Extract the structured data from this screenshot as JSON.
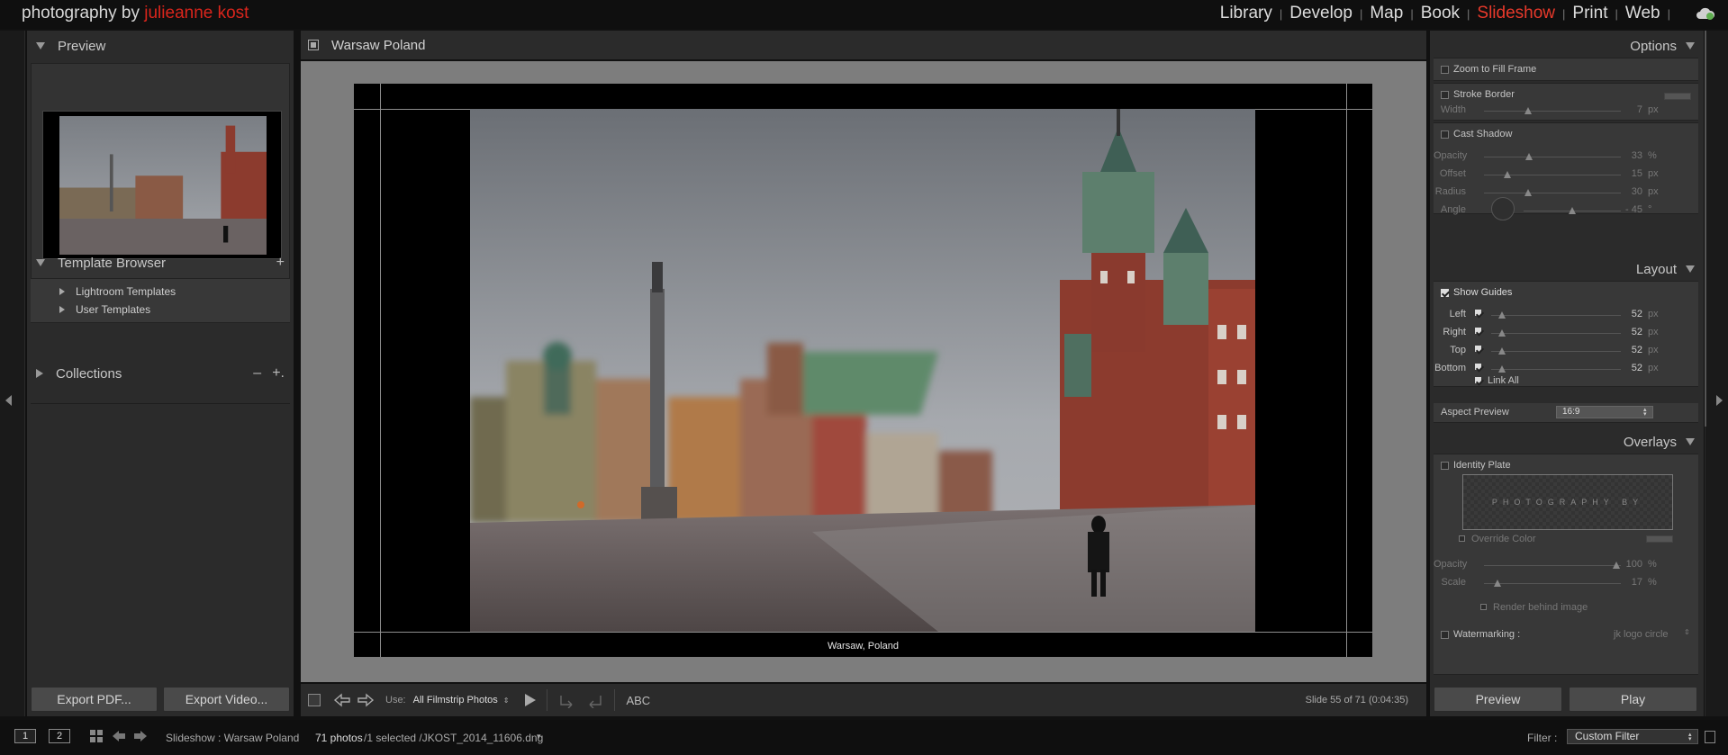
{
  "brand": {
    "prefix": "photography by ",
    "name": "julieanne kost"
  },
  "modules": [
    {
      "label": "Library",
      "active": false
    },
    {
      "label": "Develop",
      "active": false
    },
    {
      "label": "Map",
      "active": false
    },
    {
      "label": "Book",
      "active": false
    },
    {
      "label": "Slideshow",
      "active": true
    },
    {
      "label": "Print",
      "active": false
    },
    {
      "label": "Web",
      "active": false
    }
  ],
  "left_panel": {
    "preview": {
      "title": "Preview"
    },
    "template_browser": {
      "title": "Template Browser",
      "add_symbol": "+",
      "items": [
        "Lightroom Templates",
        "User Templates"
      ]
    },
    "collections": {
      "title": "Collections",
      "minus_symbol": "–",
      "plus_symbol": "+."
    },
    "export_pdf_label": "Export PDF...",
    "export_video_label": "Export Video..."
  },
  "center": {
    "title": "Warsaw Poland",
    "caption": "Warsaw, Poland",
    "toolbar": {
      "use_label": "Use:",
      "use_value": "All Filmstrip Photos",
      "abc_label": "ABC",
      "slide_info": "Slide 55 of 71 (0:04:35)"
    }
  },
  "right_panel": {
    "options": {
      "title": "Options",
      "zoom_to_fill": {
        "label": "Zoom to Fill Frame",
        "checked": false
      },
      "stroke_border": {
        "label": "Stroke Border",
        "checked": false
      },
      "width": {
        "label": "Width",
        "value": "7",
        "unit": "px",
        "level": 0.32
      },
      "cast_shadow": {
        "label": "Cast Shadow",
        "checked": false
      },
      "opacity": {
        "label": "Opacity",
        "value": "33",
        "unit": "%",
        "level": 0.33
      },
      "offset": {
        "label": "Offset",
        "value": "15",
        "unit": "px",
        "level": 0.17
      },
      "radius": {
        "label": "Radius",
        "value": "30",
        "unit": "px",
        "level": 0.32
      },
      "angle": {
        "label": "Angle",
        "value": "- 45",
        "unit": "°",
        "level": 0.5
      }
    },
    "layout": {
      "title": "Layout",
      "show_guides": {
        "label": "Show Guides",
        "checked": true
      },
      "left": {
        "label": "Left",
        "value": "52",
        "unit": "px",
        "level": 0.08
      },
      "right": {
        "label": "Right",
        "value": "52",
        "unit": "px",
        "level": 0.08
      },
      "top": {
        "label": "Top",
        "value": "52",
        "unit": "px",
        "level": 0.08
      },
      "bottom": {
        "label": "Bottom",
        "value": "52",
        "unit": "px",
        "level": 0.08
      },
      "link_all": "Link All",
      "aspect_preview_label": "Aspect Preview",
      "aspect_preview_value": "16:9"
    },
    "overlays": {
      "title": "Overlays",
      "identity_plate": {
        "label": "Identity Plate",
        "checked": false
      },
      "identity_plate_text": "PHOTOGRAPHY BY",
      "override_color": "Override Color",
      "opacity": {
        "label": "Opacity",
        "value": "100",
        "unit": "%",
        "level": 0.97
      },
      "scale": {
        "label": "Scale",
        "value": "17",
        "unit": "%",
        "level": 0.1
      },
      "render_behind": "Render behind image",
      "watermarking": {
        "label": "Watermarking :",
        "value": "jk logo circle"
      }
    },
    "preview_label": "Preview",
    "play_label": "Play"
  },
  "bottom_bar": {
    "screen1": "1",
    "screen2": "2",
    "breadcrumb": "Slideshow : Warsaw Poland",
    "photo_count": "71 photos",
    "selection": " /1 selected /JKOST_2014_11606.dng",
    "filter_label": "Filter :",
    "filter_value": "Custom Filter"
  },
  "colors": {
    "accent": "#e8392b",
    "brand_red": "#d9251c",
    "panel_bg": "#2b2b2b",
    "stage_bg": "#7d7d7d"
  }
}
